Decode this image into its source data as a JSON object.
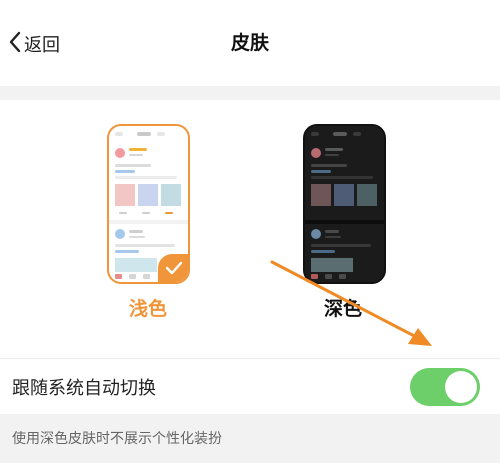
{
  "nav": {
    "back_label": "返回",
    "title": "皮肤"
  },
  "skins": [
    {
      "label": "浅色",
      "selected": true,
      "label_color": "#f0953a"
    },
    {
      "label": "深色",
      "selected": false,
      "label_color": "#111111"
    }
  ],
  "follow_system": {
    "label": "跟随系统自动切换",
    "enabled": true,
    "toggle_color": "#6ccf6a"
  },
  "hint": "使用深色皮肤时不展示个性化装扮",
  "colors": {
    "accent": "#f0953a",
    "toggle_on": "#6ccf6a"
  },
  "icons": {
    "back": "chevron-left-icon",
    "check": "check-icon",
    "annotation": "arrow-icon"
  }
}
